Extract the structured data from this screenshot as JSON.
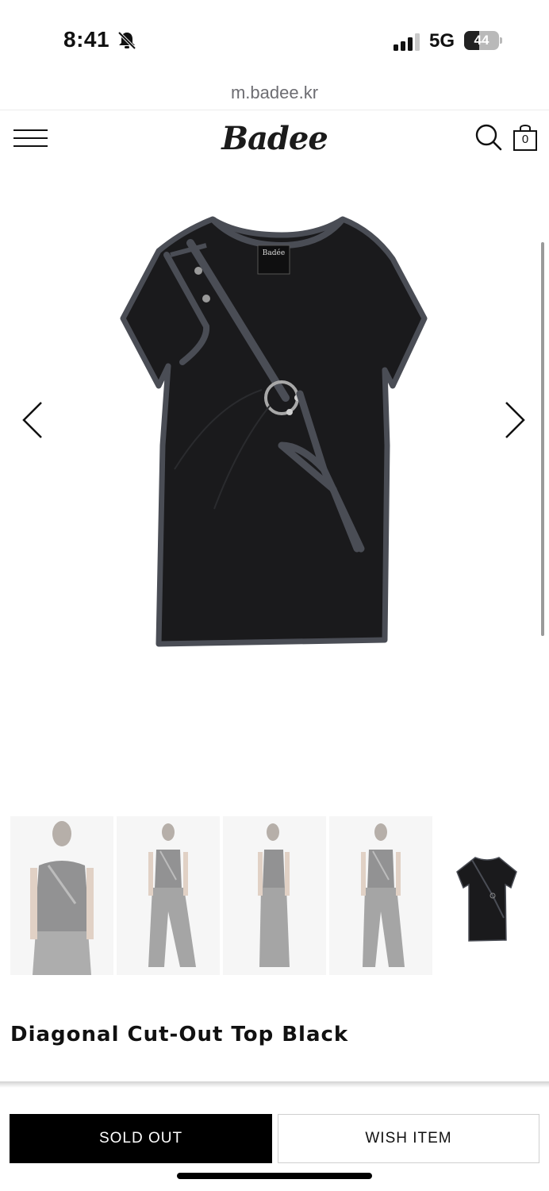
{
  "status_bar": {
    "time": "8:41",
    "network": "5G",
    "battery": "44",
    "battery_level_percent": 44,
    "icons": [
      "bell-slash-icon",
      "signal-bars-icon",
      "battery-icon"
    ]
  },
  "browser": {
    "url": "m.badee.kr"
  },
  "header": {
    "logo": "Badee",
    "cart_count": "0",
    "icons": [
      "menu-icon",
      "search-icon",
      "shopping-bag-icon"
    ]
  },
  "gallery": {
    "icons": [
      "chevron-left-icon",
      "chevron-right-icon"
    ],
    "thumbnail_count": 5,
    "active_thumbnail": 5,
    "label_text": "Badée"
  },
  "product": {
    "title": "Diagonal Cut-Out Top Black"
  },
  "actions": {
    "sold_out_label": "SOLD OUT",
    "wish_label": "WISH ITEM"
  },
  "colors": {
    "accent": "#000000",
    "shirt": "#1a1a1c",
    "trim": "#4a4d55"
  }
}
